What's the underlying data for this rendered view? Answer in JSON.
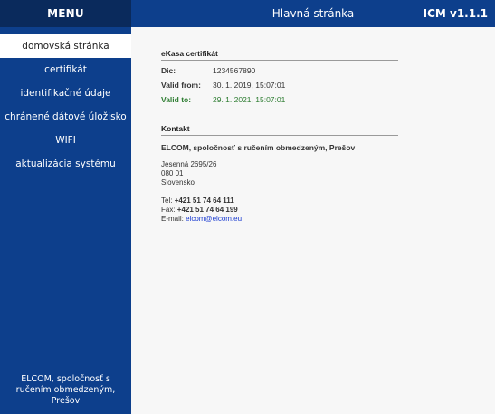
{
  "sidebar": {
    "menu_label": "MENU",
    "items": [
      {
        "label": "domovská stránka",
        "active": true
      },
      {
        "label": "certifikát",
        "active": false
      },
      {
        "label": "identifikačné údaje",
        "active": false
      },
      {
        "label": "chránené dátové úložisko",
        "active": false
      },
      {
        "label": "WIFI",
        "active": false
      },
      {
        "label": "aktualizácia systému",
        "active": false
      }
    ],
    "footer_line1": "ELCOM, spoločnosť s",
    "footer_line2": "ručením obmedzeným,",
    "footer_line3": "Prešov"
  },
  "header": {
    "title": "Hlavná stránka",
    "version": "ICM v1.1.1"
  },
  "certificate": {
    "section_title": "eKasa certifikát",
    "dic_label": "Dic:",
    "dic_value": "1234567890",
    "valid_from_label": "Valid from:",
    "valid_from_value": "30. 1. 2019, 15:07:01",
    "valid_to_label": "Valid to:",
    "valid_to_value": "29. 1. 2021, 15:07:01"
  },
  "contact": {
    "section_title": "Kontakt",
    "company": "ELCOM, spoločnosť s ručením obmedzeným, Prešov",
    "street": "Jesenná 2695/26",
    "zip": "080 01",
    "country": "Slovensko",
    "tel_label": "Tel:",
    "tel_value": "+421 51 74 64 111",
    "fax_label": "Fax:",
    "fax_value": "+421 51 74 64 199",
    "email_label": "E-mail:",
    "email_value": "elcom@elcom.eu"
  },
  "colors": {
    "sidebar_bg": "#0d3f8c",
    "menu_header_bg": "#0a2a5c",
    "valid_to_color": "#2e7d32",
    "link_color": "#1a3bd0"
  }
}
